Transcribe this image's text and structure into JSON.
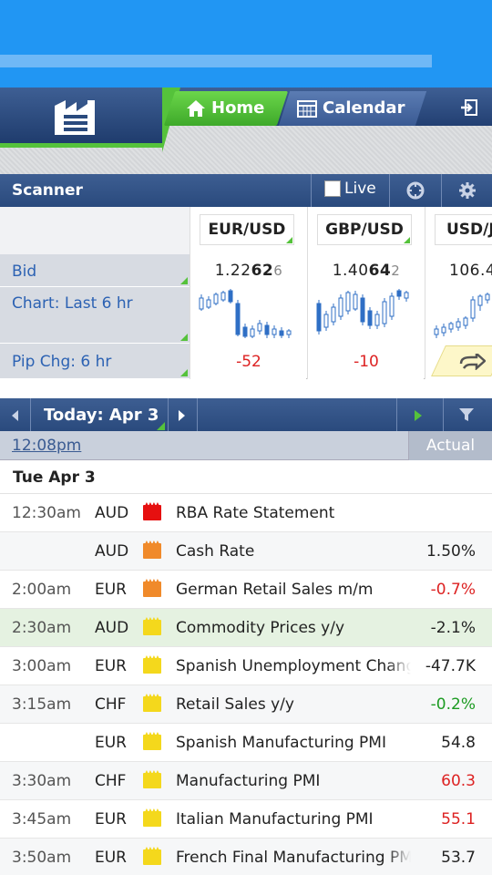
{
  "colors": {
    "accent_green": "#55c23b",
    "nav_blue": "#2a4a7d",
    "status_blue": "#2196f3",
    "down_red": "#dd2222",
    "up_green": "#1c9b22"
  },
  "nav": {
    "logo_icon": "factory-icon",
    "home_label": "Home",
    "calendar_label": "Calendar",
    "exit_icon": "exit-icon"
  },
  "scanner": {
    "title": "Scanner",
    "live_label": "Live",
    "row_labels": {
      "bid": "Bid",
      "chart": "Chart: Last 6 hr",
      "pip": "Pip Chg: 6 hr"
    },
    "pairs": [
      {
        "name": "EUR/USD",
        "bid_pre": "1.22",
        "bid_big": "62",
        "bid_small": "6",
        "pip": "-52"
      },
      {
        "name": "GBP/USD",
        "bid_pre": "1.40",
        "bid_big": "64",
        "bid_small": "2",
        "pip": "-10"
      },
      {
        "name": "USD/J",
        "bid_pre": "106.4",
        "bid_big": "",
        "bid_small": "",
        "pip": ""
      }
    ]
  },
  "calendar": {
    "date_label": "Today: Apr 3",
    "time_now": "12:08pm",
    "actual_header": "Actual",
    "day_heading": "Tue Apr 3",
    "events": [
      {
        "time": "12:30am",
        "currency": "AUD",
        "impact": "red",
        "name": "RBA Rate Statement",
        "actual": "",
        "actual_color": ""
      },
      {
        "time": "",
        "currency": "AUD",
        "impact": "orange",
        "name": "Cash Rate",
        "actual": "1.50%",
        "actual_color": ""
      },
      {
        "time": "2:00am",
        "currency": "EUR",
        "impact": "orange",
        "name": "German Retail Sales m/m",
        "actual": "-0.7%",
        "actual_color": "red"
      },
      {
        "time": "2:30am",
        "currency": "AUD",
        "impact": "yellow",
        "name": "Commodity Prices y/y",
        "actual": "-2.1%",
        "actual_color": ""
      },
      {
        "time": "3:00am",
        "currency": "EUR",
        "impact": "yellow",
        "name": "Spanish Unemployment Change",
        "actual": "-47.7K",
        "actual_color": ""
      },
      {
        "time": "3:15am",
        "currency": "CHF",
        "impact": "yellow",
        "name": "Retail Sales y/y",
        "actual": "-0.2%",
        "actual_color": "green"
      },
      {
        "time": "",
        "currency": "EUR",
        "impact": "yellow",
        "name": "Spanish Manufacturing PMI",
        "actual": "54.8",
        "actual_color": ""
      },
      {
        "time": "3:30am",
        "currency": "CHF",
        "impact": "yellow",
        "name": "Manufacturing PMI",
        "actual": "60.3",
        "actual_color": "red"
      },
      {
        "time": "3:45am",
        "currency": "EUR",
        "impact": "yellow",
        "name": "Italian Manufacturing PMI",
        "actual": "55.1",
        "actual_color": "red"
      },
      {
        "time": "3:50am",
        "currency": "EUR",
        "impact": "yellow",
        "name": "French Final Manufacturing PMI",
        "actual": "53.7",
        "actual_color": ""
      }
    ]
  }
}
